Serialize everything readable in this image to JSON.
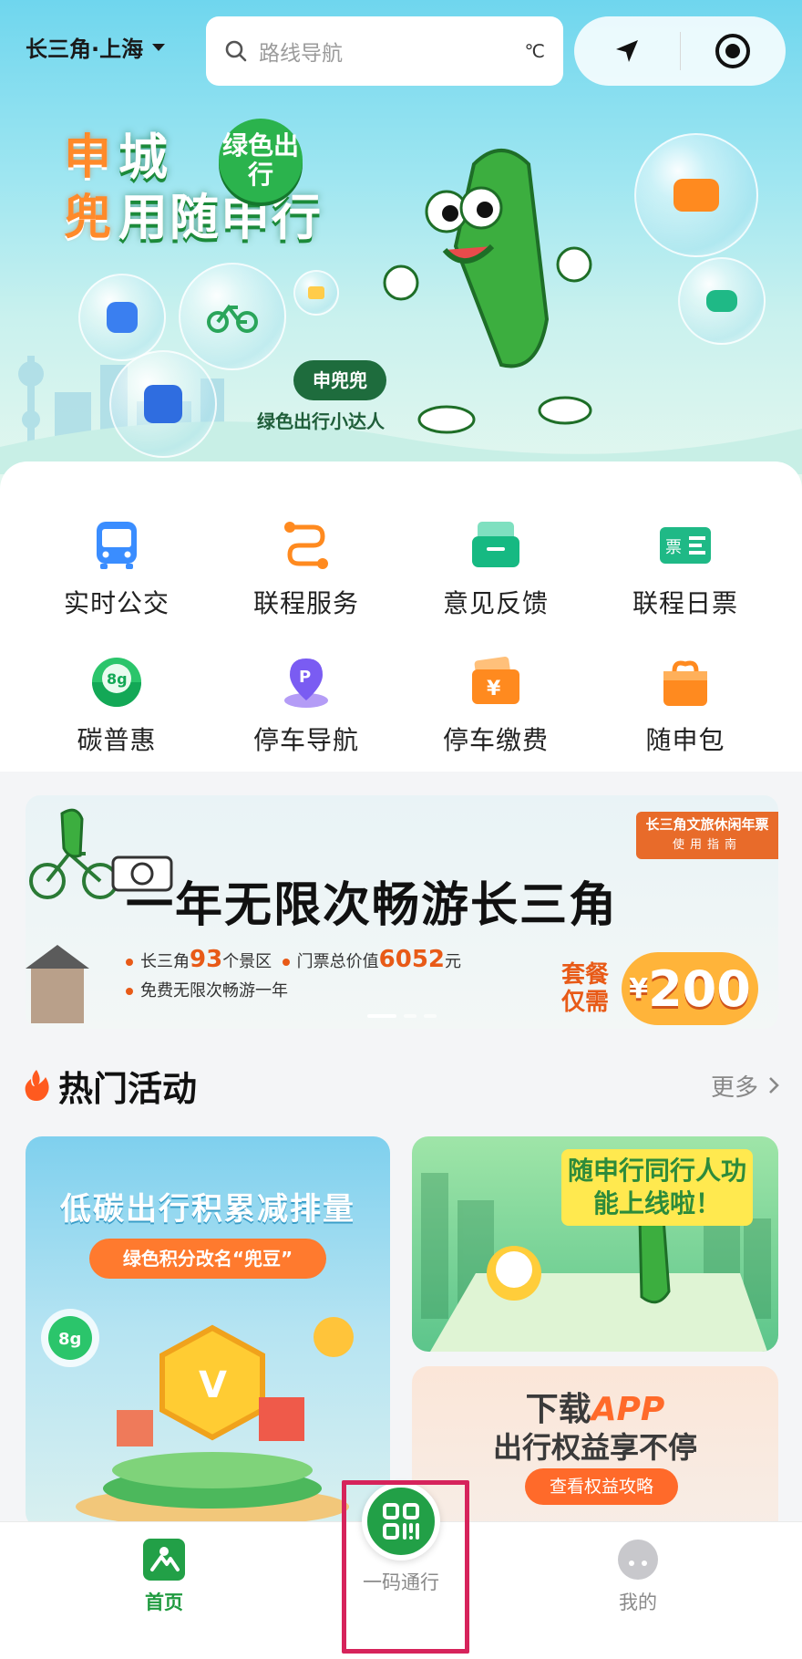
{
  "header": {
    "city": "长三角·上海",
    "search_placeholder": "路线导航",
    "weather_unit": "℃"
  },
  "hero": {
    "title_line1_quote": "申",
    "title_line1": "城",
    "title_line2_quote": "兜",
    "title_line2": "用随申行",
    "badge": "绿色出行",
    "mascot_name": "申兜兜",
    "mascot_caption": "绿色出行小达人"
  },
  "services": [
    {
      "label": "实时公交",
      "icon": "bus-icon",
      "color": "#3a8dff"
    },
    {
      "label": "联程服务",
      "icon": "route-icon",
      "color": "#ff8a1f"
    },
    {
      "label": "意见反馈",
      "icon": "inbox-icon",
      "color": "#16b982"
    },
    {
      "label": "联程日票",
      "icon": "ticket-icon",
      "color": "#1fb986"
    },
    {
      "label": "碳普惠",
      "icon": "carbon-icon",
      "color": "#2bc56b"
    },
    {
      "label": "停车导航",
      "icon": "parking-pin-icon",
      "color": "#7a5cf2"
    },
    {
      "label": "停车缴费",
      "icon": "parking-pay-icon",
      "color": "#ff8a1f"
    },
    {
      "label": "随申包",
      "icon": "gift-bag-icon",
      "color": "#ff8a1f"
    }
  ],
  "promo": {
    "tag_line1": "长三角文旅休闲年票",
    "tag_line2": "使用指南",
    "title": "一年无限次畅游长三角",
    "bullet1_prefix": "长三角",
    "bullet1_num": "93",
    "bullet1_mid": "个景区",
    "bullet1_price_prefix": "门票总价值",
    "bullet1_price": "6052",
    "bullet1_unit": "元",
    "bullet2": "免费无限次畅游一年",
    "price_label": "套餐仅需",
    "price_currency": "¥",
    "price_value": "200"
  },
  "hot": {
    "title": "热门活动",
    "more": "更多"
  },
  "activities": {
    "left_title": "低碳出行积累减排量",
    "left_pill": "绿色积分改名“兜豆”",
    "rt_title": "随申行同行人功能上线啦！",
    "rb_line1_prefix": "下载",
    "rb_line1_em": "APP",
    "rb_line2": "出行权益享不停",
    "rb_pill": "查看权益攻略"
  },
  "tabbar": {
    "home": "首页",
    "scan": "一码通行",
    "mine": "我的"
  },
  "colors": {
    "brand_green": "#22a047",
    "accent_orange": "#ff6a2a",
    "highlight": "#d6235b"
  }
}
